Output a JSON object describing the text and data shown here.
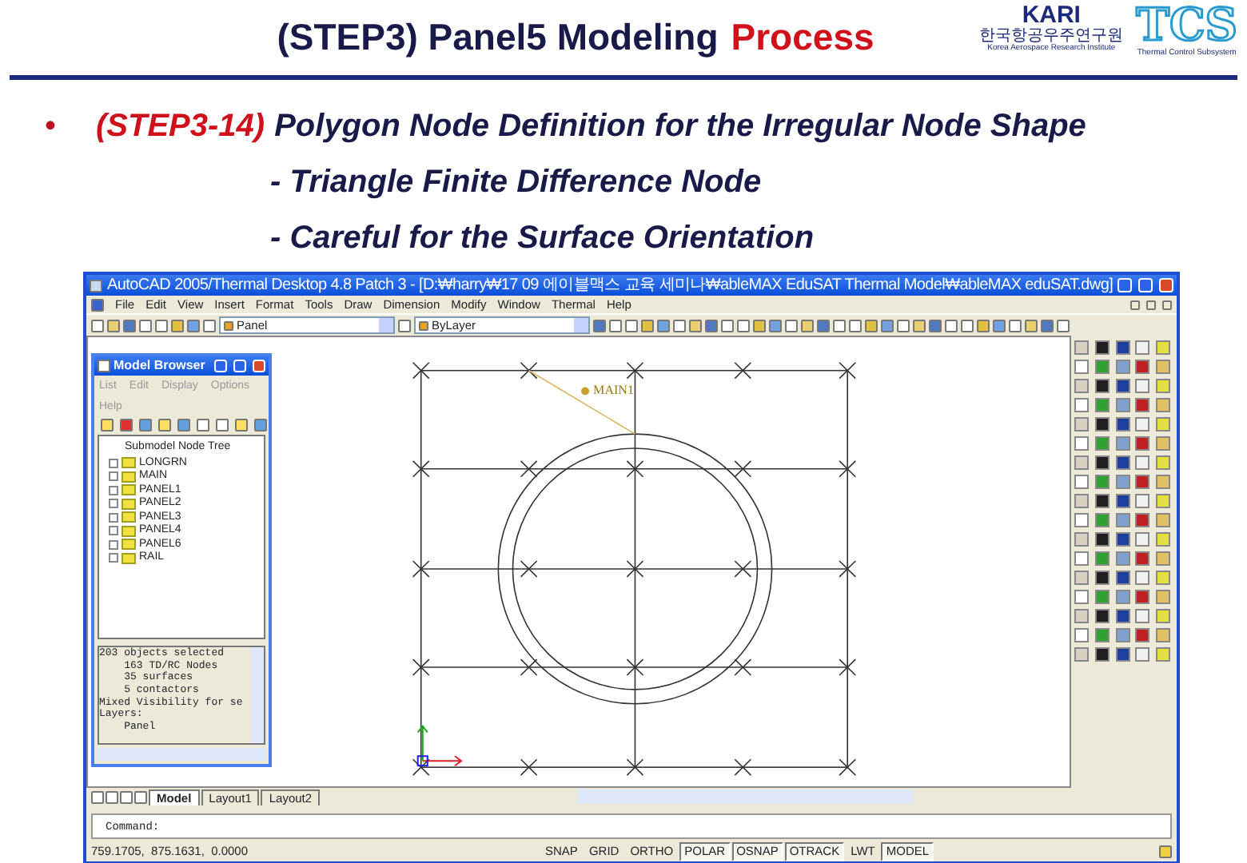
{
  "slide": {
    "title": "(STEP3) Panel5 Modeling",
    "title_accent": "Process",
    "logos": {
      "kari": {
        "name": "KARI",
        "korean": "한국항공우주연구원",
        "english": "Korea Aerospace Research Institute"
      },
      "tcs": {
        "name": "TCS",
        "subtitle": "Thermal Control Subsystem"
      }
    }
  },
  "bullet": {
    "marker": "•",
    "step": "(STEP3-14)",
    "heading": "Polygon Node Definition for the Irregular Node Shape",
    "sub_points": [
      "- Triangle Finite Difference Node",
      "- Careful for the Surface Orientation"
    ]
  },
  "app": {
    "window": {
      "title": "AutoCAD 2005/Thermal Desktop 4.8 Patch 3 - [D:₩harry₩17 09 에이블맥스 교육 세미나₩ableMAX EduSAT Thermal Model₩ableMAX eduSAT.dwg]"
    },
    "menu": [
      "File",
      "Edit",
      "View",
      "Insert",
      "Format",
      "Tools",
      "Draw",
      "Dimension",
      "Modify",
      "Window",
      "Thermal",
      "Help"
    ],
    "toolbar": {
      "layer": "Panel",
      "color_control": "ByLayer"
    },
    "model_browser": {
      "title": "Model Browser",
      "menu": [
        "List",
        "Edit",
        "Display",
        "Options",
        "Help"
      ],
      "tree_title": "Submodel Node Tree",
      "tree_items": [
        "LONGRN",
        "MAIN",
        "PANEL1",
        "PANEL2",
        "PANEL3",
        "PANEL4",
        "PANEL6",
        "RAIL"
      ],
      "info_lines": [
        "203 objects selected",
        "    163 TD/RC Nodes",
        "    35 surfaces",
        "    5 contactors",
        "Mixed Visibility for se",
        "Layers:",
        "    Panel"
      ]
    },
    "drawing": {
      "label": "MAIN1"
    },
    "layout_tabs": [
      {
        "label": "Model",
        "selected": true
      },
      {
        "label": "Layout1",
        "selected": false
      },
      {
        "label": "Layout2",
        "selected": false
      }
    ],
    "command": {
      "prompt": "Command:"
    },
    "status_bar": {
      "coordinates": "759.1705,  875.1631,  0.0000",
      "toggles": [
        {
          "label": "SNAP",
          "on": false
        },
        {
          "label": "GRID",
          "on": false
        },
        {
          "label": "ORTHO",
          "on": false
        },
        {
          "label": "POLAR",
          "on": true
        },
        {
          "label": "OSNAP",
          "on": true
        },
        {
          "label": "OTRACK",
          "on": true
        },
        {
          "label": "LWT",
          "on": false
        },
        {
          "label": "MODEL",
          "on": true
        }
      ]
    }
  }
}
